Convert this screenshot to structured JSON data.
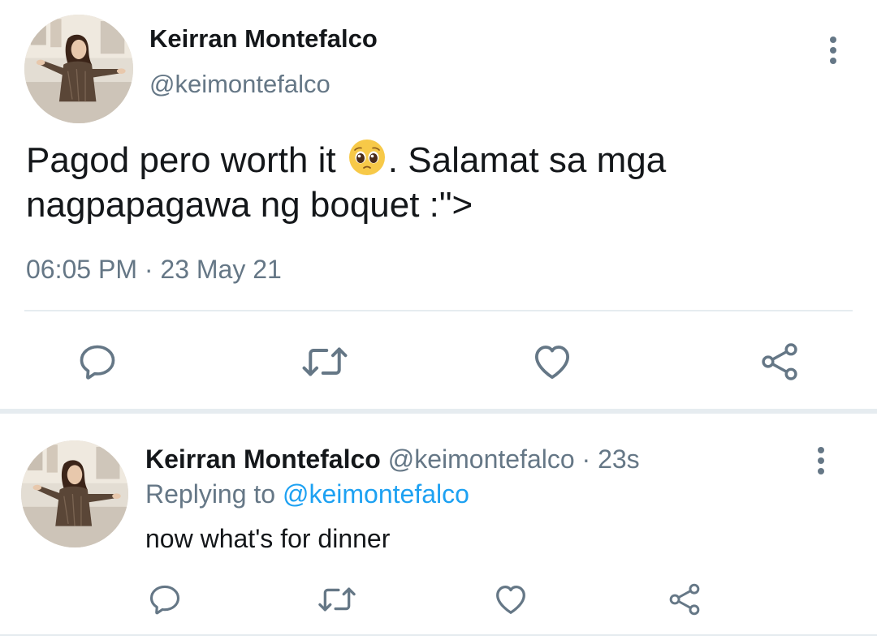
{
  "main_tweet": {
    "author_name": "Keirran Montefalco",
    "author_handle": "@keimontefalco",
    "text_before_emoji": "Pagod pero worth it ",
    "emoji": "pleading-face",
    "text_after_emoji": ". Salamat sa mga nagpapagawa ng boquet :\">",
    "time": "06:05 PM",
    "separator": " · ",
    "date": "23 May 21",
    "actions": [
      "reply-icon",
      "retweet-icon",
      "like-icon",
      "share-icon"
    ]
  },
  "reply_tweet": {
    "author_name": "Keirran Montefalco",
    "author_handle": "@keimontefalco",
    "separator": " · ",
    "time_ago": "23s",
    "replying_label": "Replying to ",
    "replying_to": "@keimontefalco",
    "text": "now what's for dinner",
    "actions": [
      "reply-icon",
      "retweet-icon",
      "like-icon",
      "share-icon"
    ]
  },
  "colors": {
    "text_primary": "#14171a",
    "text_secondary": "#657786",
    "link": "#1da1f2",
    "divider": "#e6ecf0"
  }
}
